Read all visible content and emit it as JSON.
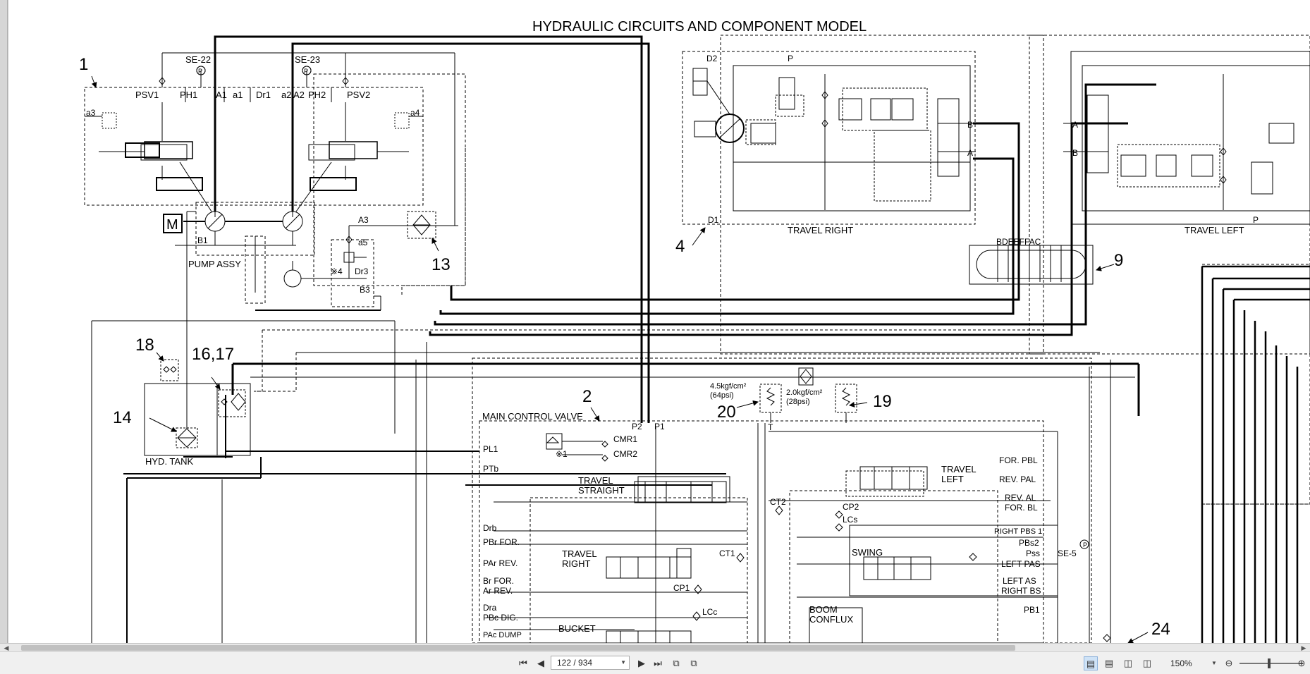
{
  "diagram": {
    "title": "HYDRAULIC CIRCUITS AND COMPONENT MODEL",
    "callouts": [
      "1",
      "4",
      "9",
      "13",
      "18",
      "16,17",
      "14",
      "2",
      "20",
      "19",
      "24"
    ],
    "ports": {
      "se22": "SE-22",
      "se23": "SE-23",
      "psv1": "PSV1",
      "ph1": "PH1",
      "a1cap": "A1",
      "a1": "a1",
      "dr1": "Dr1",
      "a2low": "a2",
      "a2cap": "A2",
      "ph2": "PH2",
      "psv2": "PSV2",
      "a3low": "a3",
      "a4low": "a4",
      "a3cap": "A3",
      "a5": "a5",
      "dr3": "Dr3",
      "b3": "B3",
      "b1": "B1",
      "star4": "※4",
      "d2": "D2",
      "p": "P",
      "b": "B",
      "a": "A",
      "d1": "D1",
      "bdeeffac": "BDEEFFAC",
      "p2": "P2",
      "p1": "P1",
      "t": "T",
      "pl1": "PL1",
      "star1": "※1",
      "cmr1": "CMR1",
      "cmr2": "CMR2",
      "ptb": "PTb",
      "drb": "Drb",
      "pbrfor": "PBr FOR.",
      "parrev": "PAr REV.",
      "brfor": "Br FOR.",
      "arrev": "Ar REV.",
      "dra": "Dra",
      "pbcdig": "PBc DIG.",
      "pacdump": "PAc DUMP",
      "ct1": "CT1",
      "ct2": "CT2",
      "cp1": "CP1",
      "cp2": "CP2",
      "lcc": "LCc",
      "lcs": "LCs",
      "forpbl": "FOR. PBL",
      "revpal": "REV. PAL",
      "reval": "REV. AL",
      "forbl": "FOR. BL",
      "rightpbs1": "RIGHT PBS 1",
      "pbs2": "PBs2",
      "pss": "Pss",
      "se5": "SE-5",
      "leftpas": "LEFT PAS",
      "leftas": "LEFT AS",
      "rightbs": "RIGHT BS",
      "pb1": "PB1",
      "relief1a": "4.5kgf/cm²",
      "relief1b": "(64psi)",
      "relief2a": "2.0kgf/cm²",
      "relief2b": "(28psi)"
    },
    "labels": {
      "pump_assy": "PUMP ASSY",
      "motor": "M",
      "hyd_tank": "HYD. TANK",
      "main_control_valve": "MAIN CONTROL VALVE",
      "travel_right": "TRAVEL RIGHT",
      "travel_left": "TRAVEL LEFT",
      "travel_straight_1": "TRAVEL",
      "travel_straight_2": "STRAIGHT",
      "travel_right_spool_1": "TRAVEL",
      "travel_right_spool_2": "RIGHT",
      "travel_left_spool_1": "TRAVEL",
      "travel_left_spool_2": "LEFT",
      "swing": "SWING",
      "bucket": "BUCKET",
      "boom_conflux_1": "BOOM",
      "boom_conflux_2": "CONFLUX",
      "pressure_symbol": "P"
    }
  },
  "toolbar": {
    "page_value": "122 / 934",
    "zoom_value": "150%"
  }
}
